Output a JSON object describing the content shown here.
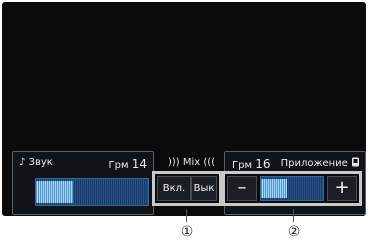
{
  "sound_panel": {
    "label": "♪ Звук",
    "gain_prefix": "Грм",
    "gain_value": "14",
    "level": 0.33
  },
  "mix": {
    "label": "))) Mix (((",
    "on_label": "Вкл.",
    "off_label": "Вык"
  },
  "app_panel": {
    "gain_prefix": "Грм",
    "gain_value": "16",
    "label": "Приложение",
    "icon": "phone-icon",
    "minus_label": "–",
    "plus_label": "+",
    "level": 0.42
  },
  "callouts": {
    "one": "①",
    "two": "②"
  }
}
